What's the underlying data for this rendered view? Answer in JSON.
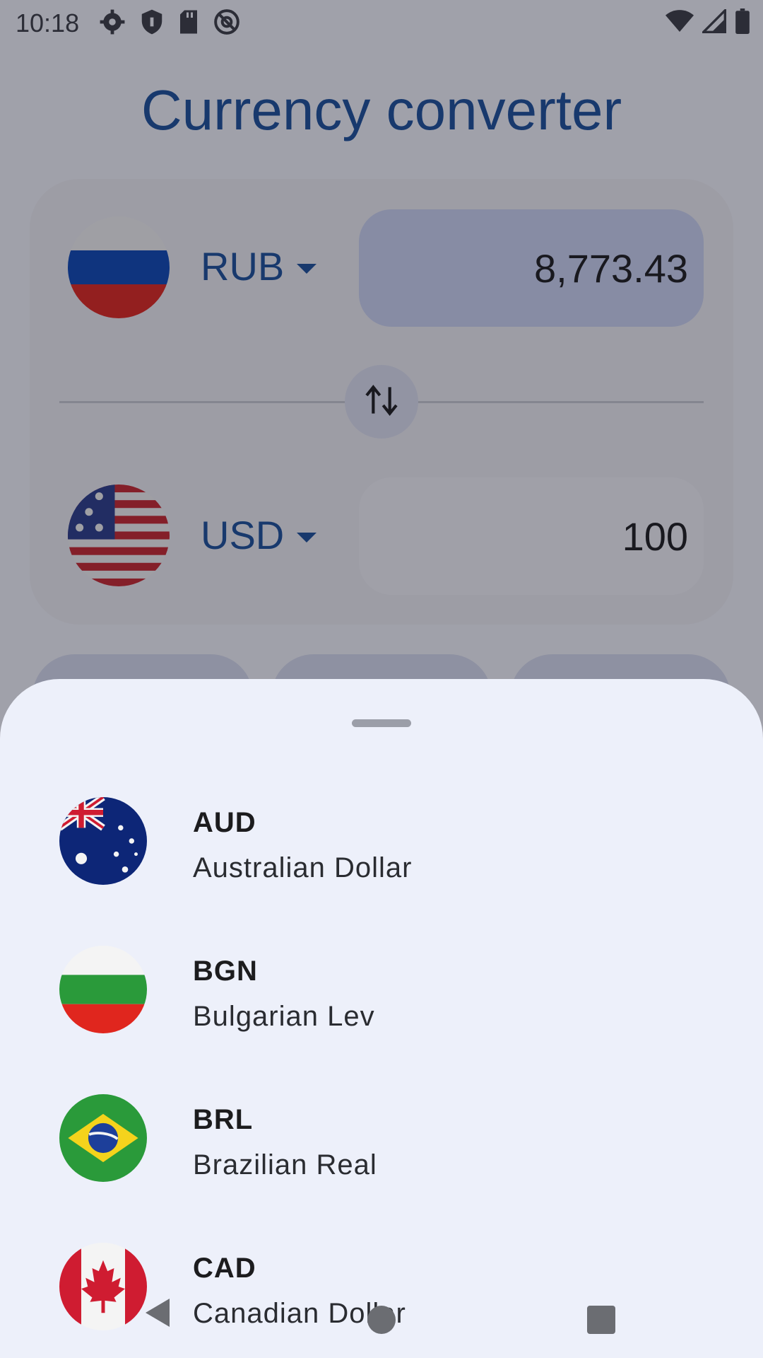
{
  "status_bar": {
    "time": "10:18",
    "left_icons": [
      "gear-icon",
      "shield-icon",
      "sd-card-icon",
      "at-sign-icon"
    ],
    "right_icons": [
      "wifi-icon",
      "cell-signal-icon",
      "battery-icon"
    ]
  },
  "app": {
    "title": "Currency converter",
    "from": {
      "code": "RUB",
      "amount": "8,773.43",
      "flag": "russia-flag"
    },
    "to": {
      "code": "USD",
      "amount": "100",
      "flag": "usa-flag"
    },
    "swap_icon": "swap-vertical-icon"
  },
  "sheet": {
    "currencies": [
      {
        "code": "AUD",
        "name": "Australian Dollar",
        "flag": "australia-flag"
      },
      {
        "code": "BGN",
        "name": "Bulgarian Lev",
        "flag": "bulgaria-flag"
      },
      {
        "code": "BRL",
        "name": "Brazilian Real",
        "flag": "brazil-flag"
      },
      {
        "code": "CAD",
        "name": "Canadian Dollar",
        "flag": "canada-flag"
      }
    ]
  },
  "nav_bar": {
    "icons": [
      "back-icon",
      "home-icon",
      "recents-icon"
    ]
  },
  "colors": {
    "accent": "#1b4f9c",
    "sheet_bg": "#edf0fa",
    "scrim": "#141622"
  }
}
